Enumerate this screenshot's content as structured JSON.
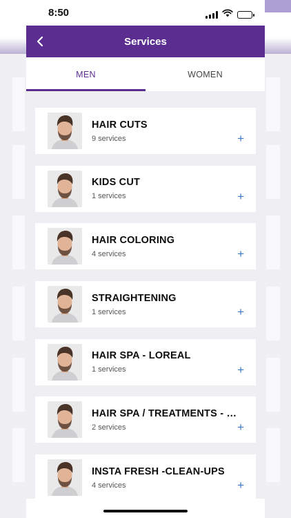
{
  "status": {
    "time": "8:50"
  },
  "header": {
    "title": "Services"
  },
  "tabs": [
    {
      "label": "MEN",
      "active": true
    },
    {
      "label": "WOMEN",
      "active": false
    }
  ],
  "categories": [
    {
      "name": "HAIR CUTS",
      "count": "9 services"
    },
    {
      "name": "KIDS CUT",
      "count": "1 services"
    },
    {
      "name": "HAIR COLORING",
      "count": "4 services"
    },
    {
      "name": "STRAIGHTENING",
      "count": "1 services"
    },
    {
      "name": "HAIR SPA - LOREAL",
      "count": "1 services"
    },
    {
      "name": "HAIR SPA / TREATMENTS - WE…",
      "count": "2 services"
    },
    {
      "name": "INSTA FRESH -CLEAN-UPS",
      "count": "4 services"
    }
  ],
  "icons": {
    "add": "+",
    "back": "chevron-left-icon"
  },
  "colors": {
    "brand": "#5b2d91",
    "accent": "#3a78c3"
  }
}
